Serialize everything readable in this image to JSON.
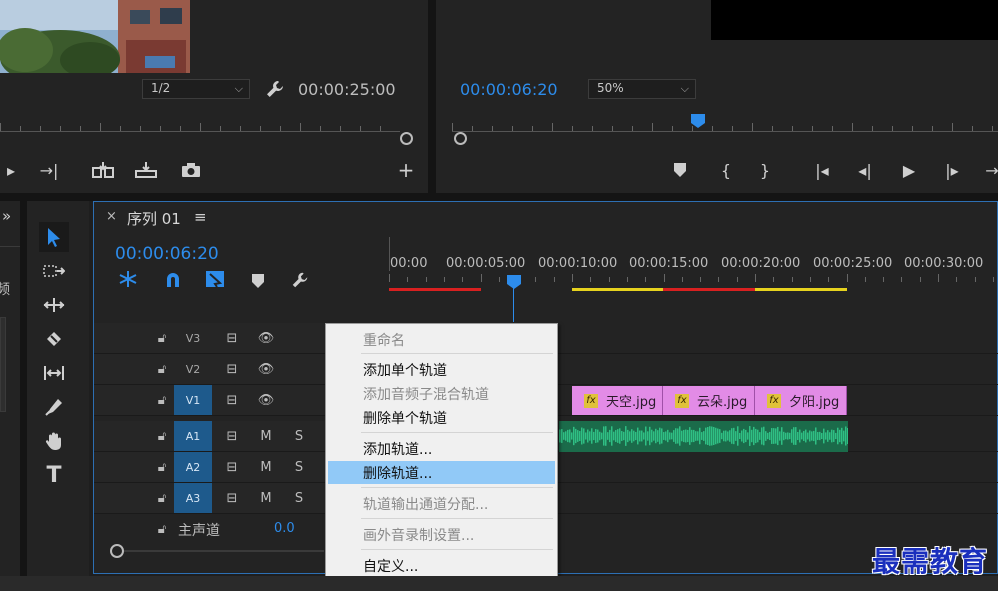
{
  "source": {
    "resolution": "1/2",
    "duration": "00:00:25:00"
  },
  "program": {
    "timecode": "00:00:06:20",
    "zoom": "50%"
  },
  "timeline": {
    "close": "×",
    "tab_title": "序列 01",
    "menu_glyph": "≡",
    "timecode": "00:00:06:20",
    "ruler": [
      "00:00",
      "00:00:05:00",
      "00:00:10:00",
      "00:00:15:00",
      "00:00:20:00",
      "00:00:25:00",
      "00:00:30:00"
    ],
    "tracks": {
      "v3": "V3",
      "v2": "V2",
      "v1": "V1",
      "a1": "A1",
      "a2": "A2",
      "a3": "A3"
    },
    "mute": "M",
    "solo": "S",
    "master_label": "主声道",
    "master_value": "0.0",
    "clips": {
      "fx": "fx",
      "c1": "天空.jpg",
      "c2": "云朵.jpg",
      "c3": "夕阳.jpg"
    }
  },
  "left_partial": {
    "chevron": "»",
    "label": "频"
  },
  "context_menu": {
    "rename": "重命名",
    "add_single": "添加单个轨道",
    "add_submix": "添加音频子混合轨道",
    "delete_single": "删除单个轨道",
    "add_tracks": "添加轨道...",
    "delete_tracks": "删除轨道...",
    "track_output": "轨道输出通道分配...",
    "voiceover": "画外音录制设置...",
    "customize": "自定义..."
  },
  "watermark": "最需教育",
  "colors": {
    "accent_blue": "#2d8ceb",
    "clip_pink": "#e28be6",
    "audio_green": "#2fbf84",
    "menu_highlight": "#91c9f7"
  }
}
